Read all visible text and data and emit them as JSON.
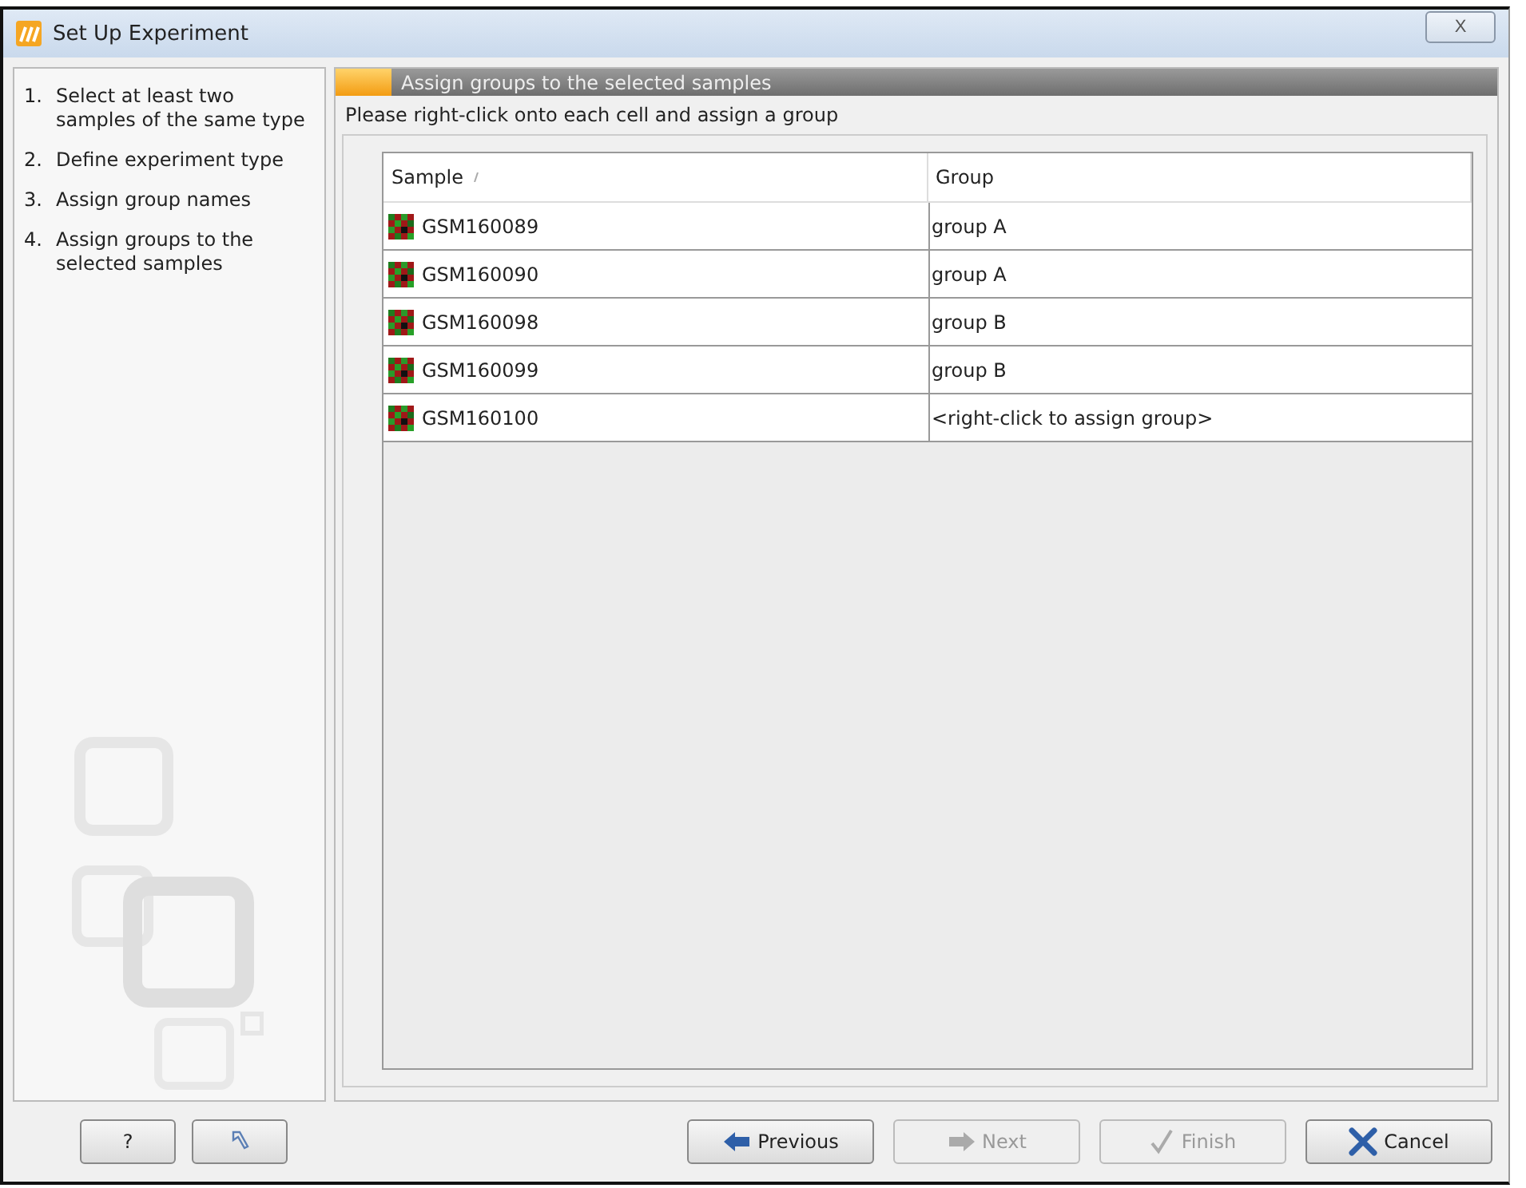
{
  "window": {
    "title": "Set Up Experiment",
    "close": "X"
  },
  "steps": [
    {
      "number": "1.",
      "label": "Select at least two samples of the same type"
    },
    {
      "number": "2.",
      "label": "Define experiment type"
    },
    {
      "number": "3.",
      "label": "Assign group names"
    },
    {
      "number": "4.",
      "label": "Assign groups to the selected samples"
    }
  ],
  "panel": {
    "header": "Assign groups to the selected samples",
    "instruction": "Please right-click onto each cell and assign a group"
  },
  "table": {
    "columns": [
      "Sample",
      "Group"
    ],
    "rows": [
      {
        "sample": "GSM160089",
        "group": "group A"
      },
      {
        "sample": "GSM160090",
        "group": "group A"
      },
      {
        "sample": "GSM160098",
        "group": "group B"
      },
      {
        "sample": "GSM160099",
        "group": "group B"
      },
      {
        "sample": "GSM160100",
        "group": "<right-click to assign group>"
      }
    ]
  },
  "left_buttons": [
    {
      "kind": "help",
      "label": "?"
    },
    {
      "kind": "reset"
    }
  ],
  "buttons": [
    {
      "kind": "previous",
      "label": "Previous",
      "disabled": false
    },
    {
      "kind": "next",
      "label": "Next",
      "disabled": true
    },
    {
      "kind": "finish",
      "label": "Finish",
      "disabled": true
    },
    {
      "kind": "cancel",
      "label": "Cancel",
      "disabled": false
    }
  ]
}
